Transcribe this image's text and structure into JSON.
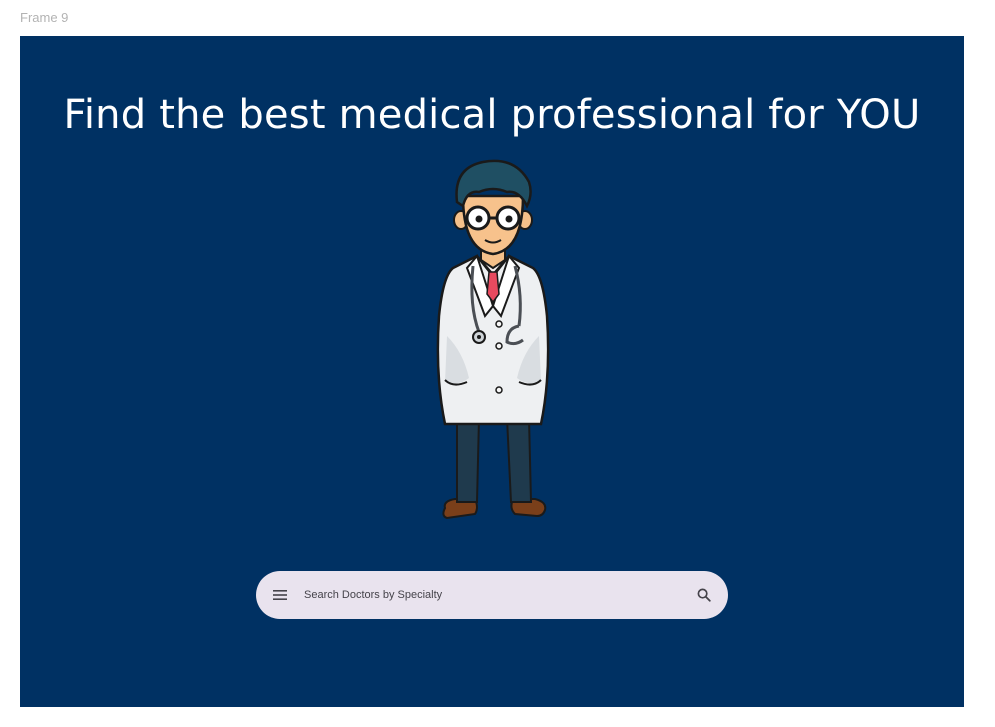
{
  "frame": {
    "label": "Frame 9"
  },
  "hero": {
    "headline": "Find the best medical professional for YOU",
    "illustration": "doctor-illustration"
  },
  "search": {
    "placeholder": "Search Doctors by Specialty",
    "leading_icon": "menu-icon",
    "trailing_icon": "search-icon"
  },
  "colors": {
    "background": "#003163",
    "search_bar": "#e9e3ee",
    "headline_text": "#ffffff"
  }
}
